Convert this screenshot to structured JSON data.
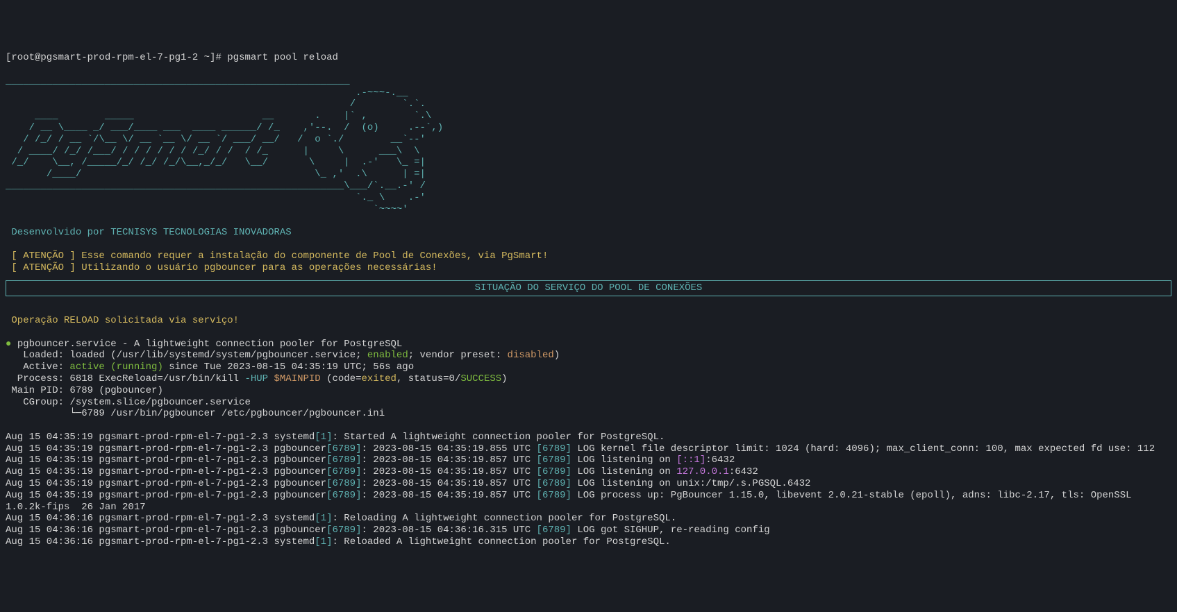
{
  "prompt": "[root@pgsmart-prod-rpm-el-7-pg1-2 ~]# ",
  "command": "pgsmart pool reload",
  "ascii_art": "___________________________________________________________\n                                                            .-~~~-.__\n                                                           /        `.`.\n     ____        _____                      __       .    |` ,        `.\\\n    / __ \\____ _/ ___/____ ___  ____ ______/ /_    ,'--.  /  (o)     .--`,)\n   / /_/ / __ `/\\__ \\/ __ `__ \\/ __ `/ ___/ __/   /  o `./        __`--'\n  / ____/ /_/ /___/ / / / / / / /_/ / /  / /_      |     \\      ___\\  \\\n /_/    \\__, /_____/_/ /_/ /_/\\__,_/_/   \\__/       \\     |  .-'   \\_ =|\n       /____/                                        \\_ ,'  .\\      | =|\n__________________________________________________________\\___/`.__.-' /\n                                                            `._ \\    .-'\n                                                               `~~~~'",
  "developed_by": "Desenvolvido por TECNISYS TECNOLOGIAS INOVADORAS",
  "attention_prefix": "[ ATENÇÃO ]",
  "attention1": " Esse comando requer a instalação do componente de Pool de Conexões, via PgSmart!",
  "attention2": " Utilizando o usuário pgbouncer para as operações necessárias!",
  "status_header": "SITUAÇÃO DO SERVIÇO DO POOL DE CONEXÕES",
  "reload_msg": "Operação RELOAD solicitada via serviço!",
  "service": {
    "dot": "●",
    "name": "pgbouncer.service - A lightweight connection pooler for PostgreSQL",
    "loaded_label": "   Loaded: ",
    "loaded_text1": "loaded (/usr/lib/systemd/system/pgbouncer.service; ",
    "enabled": "enabled",
    "loaded_text2": "; vendor preset: ",
    "disabled": "disabled",
    "loaded_text3": ")",
    "active_label": "   Active: ",
    "active_text": "active (running)",
    "active_since": " since Tue 2023-08-15 04:35:19 UTC; 56s ago",
    "process_label": "  Process: ",
    "process_text1": "6818 ExecReload=/usr/bin/kill ",
    "hup": "-HUP",
    "space1": " ",
    "mainpid_var": "$MAINPID",
    "process_text2": " (code=",
    "exited": "exited",
    "process_text3": ", status=0/",
    "success": "SUCCESS",
    "process_text4": ")",
    "mainpid_label": " Main PID: ",
    "mainpid_text": "6789 (pgbouncer)",
    "cgroup_label": "   CGroup: ",
    "cgroup_text": "/system.slice/pgbouncer.service",
    "cgroup_sub": "           └─6789 /usr/bin/pgbouncer /etc/pgbouncer/pgbouncer.ini"
  },
  "logs": {
    "l1_prefix": "Aug 15 04:35:19 pgsmart-prod-rpm-el-7-pg1-2.3 systemd",
    "l1_pid": "[1]",
    "l1_text": ": Started A lightweight connection pooler for PostgreSQL.",
    "l2_prefix": "Aug 15 04:35:19 pgsmart-prod-rpm-el-7-pg1-2.3 pgbouncer",
    "l2_pid": "[6789]",
    "l2_text1": ": 2023-08-15 04:35:19.855 UTC ",
    "l2_pid2": "[6789]",
    "l2_text2": " LOG kernel file descriptor limit: 1024 (hard: 4096); max_client_conn: 100, max expected fd use: 112",
    "l3_prefix": "Aug 15 04:35:19 pgsmart-prod-rpm-el-7-pg1-2.3 pgbouncer",
    "l3_pid": "[6789]",
    "l3_text1": ": 2023-08-15 04:35:19.857 UTC ",
    "l3_pid2": "[6789]",
    "l3_text2": " LOG listening on ",
    "l3_addr": "[::1]",
    "l3_port": ":6432",
    "l4_prefix": "Aug 15 04:35:19 pgsmart-prod-rpm-el-7-pg1-2.3 pgbouncer",
    "l4_pid": "[6789]",
    "l4_text1": ": 2023-08-15 04:35:19.857 UTC ",
    "l4_pid2": "[6789]",
    "l4_text2": " LOG listening on ",
    "l4_addr": "127.0.0.1",
    "l4_port": ":6432",
    "l5_prefix": "Aug 15 04:35:19 pgsmart-prod-rpm-el-7-pg1-2.3 pgbouncer",
    "l5_pid": "[6789]",
    "l5_text1": ": 2023-08-15 04:35:19.857 UTC ",
    "l5_pid2": "[6789]",
    "l5_text2": " LOG listening on unix:/tmp/.s.PGSQL.6432",
    "l6_prefix": "Aug 15 04:35:19 pgsmart-prod-rpm-el-7-pg1-2.3 pgbouncer",
    "l6_pid": "[6789]",
    "l6_text1": ": 2023-08-15 04:35:19.857 UTC ",
    "l6_pid2": "[6789]",
    "l6_text2": " LOG process up: PgBouncer 1.15.0, libevent 2.0.21-stable (epoll), adns: libc-2.17, tls: OpenSSL 1.0.2k-fips  26 Jan 2017",
    "l7_prefix": "Aug 15 04:36:16 pgsmart-prod-rpm-el-7-pg1-2.3 systemd",
    "l7_pid": "[1]",
    "l7_text": ": Reloading A lightweight connection pooler for PostgreSQL.",
    "l8_prefix": "Aug 15 04:36:16 pgsmart-prod-rpm-el-7-pg1-2.3 pgbouncer",
    "l8_pid": "[6789]",
    "l8_text1": ": 2023-08-15 04:36:16.315 UTC ",
    "l8_pid2": "[6789]",
    "l8_text2": " LOG got SIGHUP, re-reading config",
    "l9_prefix": "Aug 15 04:36:16 pgsmart-prod-rpm-el-7-pg1-2.3 systemd",
    "l9_pid": "[1]",
    "l9_text": ": Reloaded A lightweight connection pooler for PostgreSQL."
  }
}
